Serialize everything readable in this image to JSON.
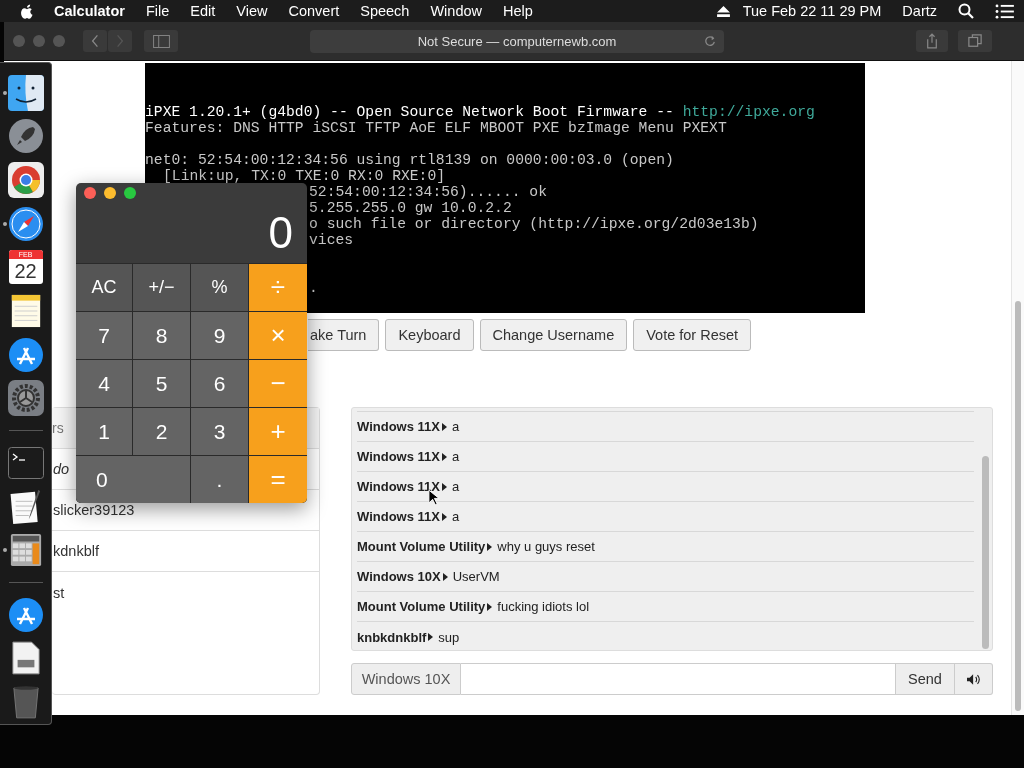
{
  "menu_bar": {
    "app_name": "Calculator",
    "menus": [
      "File",
      "Edit",
      "View",
      "Convert",
      "Speech",
      "Window",
      "Help"
    ],
    "clock": "Tue Feb 22  11 29 PM",
    "user": "Dartz"
  },
  "browser": {
    "address": "Not Secure — computernewb.com"
  },
  "terminal": {
    "lines": [
      {
        "kind": "banner",
        "text": "iPXE 1.20.1+ (g4bd0) -- Open Source Network Boot Firmware -- ",
        "link": "http://ipxe.org"
      },
      {
        "kind": "plain",
        "text": "Features: DNS HTTP iSCSI TFTP AoE ELF MBOOT PXE bzImage Menu PXEXT"
      },
      {
        "kind": "blank"
      },
      {
        "kind": "plain",
        "text": "net0: 52:54:00:12:34:56 using rtl8139 on 0000:00:03.0 (open)"
      },
      {
        "kind": "indent",
        "text": "[Link:up, TX:0 TXE:0 RX:0 RXE:0]"
      },
      {
        "kind": "covered",
        "text": "52:54:00:12:34:56)...... ok"
      },
      {
        "kind": "covered",
        "text": "5.255.255.0 gw 10.0.2.2"
      },
      {
        "kind": "covered",
        "text": "o such file or directory (http://ipxe.org/2d03e13b)"
      },
      {
        "kind": "covered",
        "text": "vices"
      },
      {
        "kind": "blank"
      },
      {
        "kind": "blank"
      },
      {
        "kind": "covered",
        "text": "."
      }
    ]
  },
  "vm_buttons": [
    "ake Turn",
    "Keyboard",
    "Change Username",
    "Vote for Reset"
  ],
  "users": {
    "header": "rs",
    "rows": [
      {
        "name": "do",
        "current": true
      },
      {
        "name": "slicker39123",
        "current": false
      },
      {
        "name": "kdnkblf",
        "current": false
      },
      {
        "name": "st",
        "current": false
      }
    ]
  },
  "chat": {
    "messages": [
      {
        "user": "Windows 11X",
        "text": "a"
      },
      {
        "user": "Windows 11X",
        "text": "a"
      },
      {
        "user": "Windows 11X",
        "text": "a"
      },
      {
        "user": "Windows 11X",
        "text": "a"
      },
      {
        "user": "Mount Volume Utility",
        "text": "why u guys reset"
      },
      {
        "user": "Windows 10X",
        "text": "UserVM"
      },
      {
        "user": "Mount Volume Utility",
        "text": "fucking idiots lol"
      },
      {
        "user": "knbkdnkblf",
        "text": "sup"
      }
    ],
    "username": "Windows 10X",
    "send": "Send"
  },
  "calculator": {
    "display": "0",
    "keys": [
      {
        "label": "AC",
        "kind": "function"
      },
      {
        "label": "+/−",
        "kind": "function"
      },
      {
        "label": "%",
        "kind": "function"
      },
      {
        "label": "÷",
        "kind": "operator"
      },
      {
        "label": "7",
        "kind": "digit"
      },
      {
        "label": "8",
        "kind": "digit"
      },
      {
        "label": "9",
        "kind": "digit"
      },
      {
        "label": "×",
        "kind": "operator"
      },
      {
        "label": "4",
        "kind": "digit"
      },
      {
        "label": "5",
        "kind": "digit"
      },
      {
        "label": "6",
        "kind": "digit"
      },
      {
        "label": "−",
        "kind": "operator"
      },
      {
        "label": "1",
        "kind": "digit"
      },
      {
        "label": "2",
        "kind": "digit"
      },
      {
        "label": "3",
        "kind": "digit"
      },
      {
        "label": "+",
        "kind": "operator"
      },
      {
        "label": "0",
        "kind": "wide"
      },
      {
        "label": ".",
        "kind": "digit"
      },
      {
        "label": "=",
        "kind": "operator"
      }
    ]
  },
  "dock": {
    "items": [
      {
        "kind": "finder",
        "running": true
      },
      {
        "kind": "rocket",
        "running": false
      },
      {
        "kind": "browser",
        "running": false
      },
      {
        "kind": "compass",
        "running": true
      },
      {
        "kind": "calendar",
        "running": false,
        "month": "FEB",
        "day": "22"
      },
      {
        "kind": "notes",
        "running": false
      },
      {
        "kind": "store",
        "running": false
      },
      {
        "kind": "gear",
        "running": false
      },
      {
        "kind": "separator"
      },
      {
        "kind": "terminal",
        "running": false
      },
      {
        "kind": "textedit",
        "running": false
      },
      {
        "kind": "calculator",
        "running": true
      },
      {
        "kind": "separator"
      },
      {
        "kind": "store",
        "running": false
      },
      {
        "kind": "document",
        "running": false
      },
      {
        "kind": "trash",
        "running": false
      }
    ]
  }
}
